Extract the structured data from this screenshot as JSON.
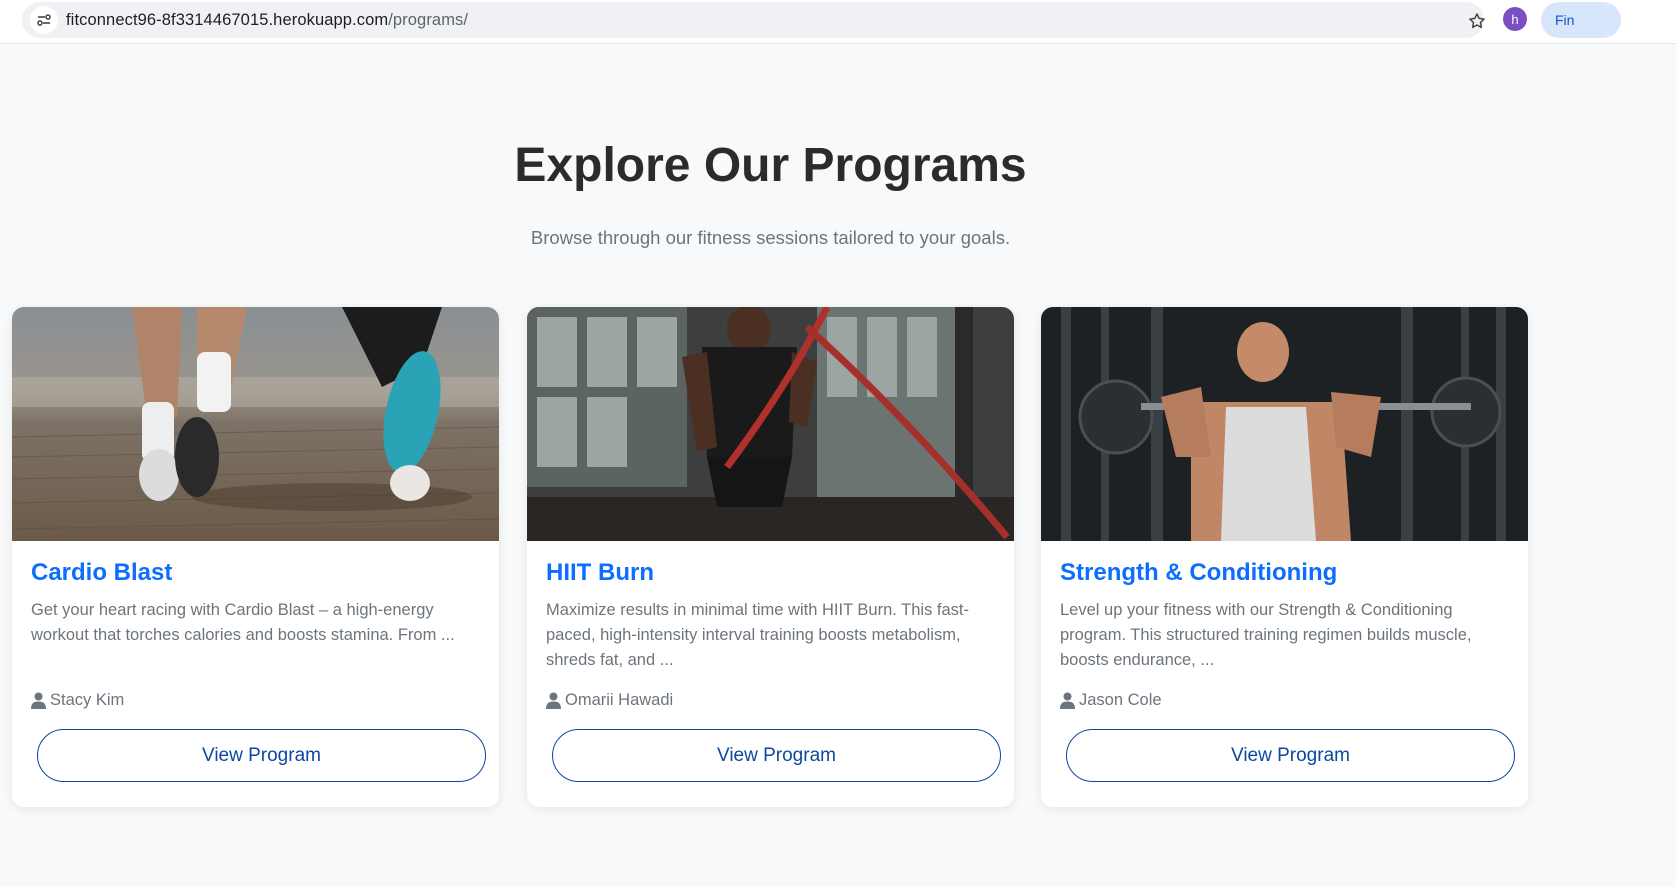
{
  "browser": {
    "url_domain": "fitconnect96-8f3314467015.herokuapp.com",
    "url_path": "/programs/",
    "profile_initial": "h",
    "extension_label": "Fin"
  },
  "header": {
    "title": "Explore Our Programs",
    "subtitle": "Browse through our fitness sessions tailored to your goals."
  },
  "programs": [
    {
      "title": "Cardio Blast",
      "description": "Get your heart racing with Cardio Blast – a high-energy workout that torches calories and boosts stamina. From ...",
      "trainer": "Stacy Kim",
      "button_label": "View Program",
      "image_icon": "running-photo"
    },
    {
      "title": "HIIT Burn",
      "description": "Maximize results in minimal time with HIIT Burn. This fast-paced, high-intensity interval training boosts metabolism, shreds fat, and ...",
      "trainer": "Omarii Hawadi",
      "button_label": "View Program",
      "image_icon": "battle-ropes-photo"
    },
    {
      "title": "Strength & Conditioning",
      "description": "Level up your fitness with our Strength & Conditioning program. This structured training regimen builds muscle, boosts endurance, ...",
      "trainer": "Jason Cole",
      "button_label": "View Program",
      "image_icon": "barbell-squat-photo"
    }
  ],
  "colors": {
    "accent": "#0d6efd",
    "button_border": "#0d47a1",
    "muted_text": "#6c757d",
    "page_bg": "#f8f9fa"
  }
}
